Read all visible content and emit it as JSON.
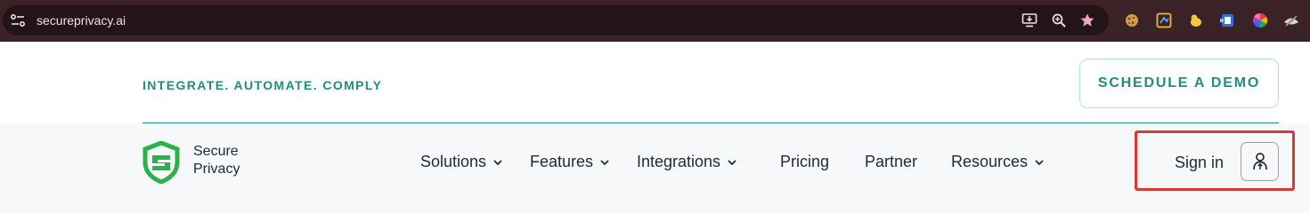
{
  "browser": {
    "url": "secureprivacy.ai",
    "icons": [
      "site-settings-icon",
      "install-app-icon",
      "zoom-icon",
      "bookmark-star-icon"
    ],
    "extensions": [
      "cookie-extension-icon",
      "color-picker-extension-icon",
      "duck-extension-icon",
      "extension-icon",
      "color-wheel-extension-icon",
      "hide-extension-icon"
    ]
  },
  "top": {
    "tagline": "INTEGRATE. AUTOMATE. COMPLY",
    "demo_button": "SCHEDULE A DEMO"
  },
  "nav": {
    "logo_line1": "Secure",
    "logo_line2": "Privacy",
    "items": [
      {
        "label": "Solutions",
        "dropdown": true
      },
      {
        "label": "Features",
        "dropdown": true
      },
      {
        "label": "Integrations",
        "dropdown": true
      },
      {
        "label": "Pricing",
        "dropdown": false
      },
      {
        "label": "Partner",
        "dropdown": false
      },
      {
        "label": "Resources",
        "dropdown": true
      }
    ],
    "sign_in": "Sign in"
  },
  "colors": {
    "brand_green": "#1f8f7a",
    "logo_green": "#2bb34a",
    "highlight_red": "#e03535",
    "browser_bg": "#3a2226"
  }
}
